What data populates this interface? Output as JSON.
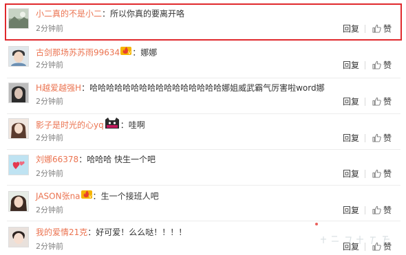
{
  "colors": {
    "username": "#eb7350",
    "text": "#333333",
    "time": "#808080",
    "highlight_border": "#e0282c",
    "divider": "#ececec"
  },
  "actions": {
    "reply_label": "回复",
    "like_label": "赞"
  },
  "comments": [
    {
      "username": "小二真的不是小二",
      "badge": "",
      "text": "所以你真的要离开咯",
      "time": "2分钟前",
      "avatar": "landscape-avatar",
      "highlighted": true
    },
    {
      "username": "古剑那场苏苏雨99634",
      "badge": "vip-fire-badge",
      "text": "娜娜",
      "time": "2分钟前",
      "avatar": "boy-avatar",
      "highlighted": false
    },
    {
      "username": "H越爱越强H",
      "badge": "",
      "text": "哈哈哈哈哈哈哈哈哈哈哈哈哈哈哈哈娜姐威武霸气厉害啦word娜",
      "time": "2分钟前",
      "avatar": "portrait-avatar",
      "highlighted": false
    },
    {
      "username": "影子是时光的心yq",
      "badge": "cat-badge",
      "text": "哇啊",
      "time": "2分钟前",
      "avatar": "girl-avatar",
      "highlighted": false
    },
    {
      "username": "刘娜66378",
      "badge": "",
      "text": "哈哈哈  快生一个吧",
      "time": "2分钟前",
      "avatar": "hearts-avatar",
      "highlighted": false
    },
    {
      "username": "JASON张na",
      "badge": "vip-fire-badge",
      "text": "生一个接班人吧",
      "time": "2分钟前",
      "avatar": "woman-avatar",
      "highlighted": false
    },
    {
      "username": "我的爱情21克",
      "badge": "",
      "text": "好可爱！么么哒！！！！",
      "time": "2分钟前",
      "avatar": "child-avatar",
      "highlighted": false
    }
  ]
}
